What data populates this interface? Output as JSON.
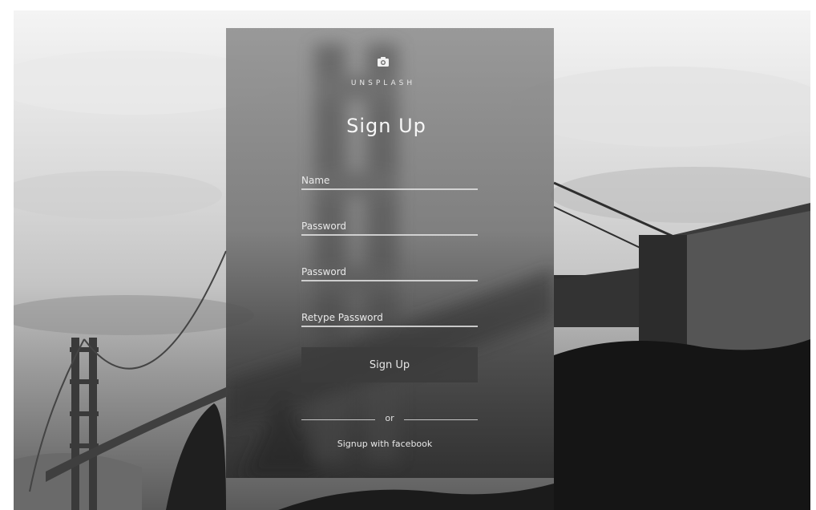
{
  "brand": {
    "name": "UNSPLASH",
    "logo_icon": "camera-icon"
  },
  "form": {
    "title": "Sign Up",
    "fields": [
      {
        "placeholder": "Name",
        "value": ""
      },
      {
        "placeholder": "Password",
        "value": ""
      },
      {
        "placeholder": "Password",
        "value": ""
      },
      {
        "placeholder": "Retype Password",
        "value": ""
      }
    ],
    "submit_label": "Sign Up",
    "divider_text": "or",
    "facebook_link": "Signup with facebook"
  },
  "colors": {
    "panel": "#6e6e6e",
    "button": "#3c3c3c",
    "text": "#f0f0f0"
  }
}
